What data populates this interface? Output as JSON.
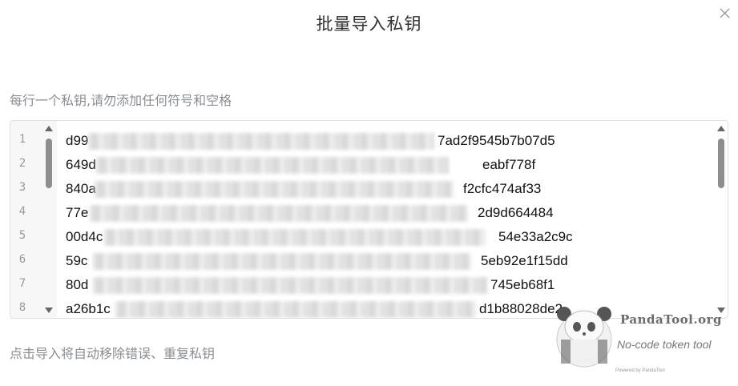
{
  "dialog": {
    "title": "批量导入私钥",
    "close_icon": "close-icon"
  },
  "form": {
    "hint": "每行一个私钥,请勿添加任何符号和空格",
    "footer": "点击导入将自动移除错误、重复私钥"
  },
  "editor": {
    "lines": [
      {
        "num": "1",
        "prefix": "d99",
        "suffix": "7ad2f9545b7b07d5"
      },
      {
        "num": "2",
        "prefix": "649d",
        "suffix": "eabf778f"
      },
      {
        "num": "3",
        "prefix": "840a",
        "suffix": "f2cfc474af33"
      },
      {
        "num": "4",
        "prefix": "77e",
        "suffix": "2d9d664484"
      },
      {
        "num": "5",
        "prefix": "00d4c",
        "suffix": "54e33a2c9c"
      },
      {
        "num": "6",
        "prefix": "59c",
        "suffix": "5eb92e1f15dd"
      },
      {
        "num": "7",
        "prefix": "80d",
        "suffix": "745eb68f1"
      },
      {
        "num": "8",
        "prefix": "a26b1c",
        "suffix": "d1b88028de2"
      }
    ]
  },
  "watermark": {
    "name": "PandaTool.org",
    "tagline": "No-code token tool",
    "powered": "Powered by PandaTool"
  }
}
